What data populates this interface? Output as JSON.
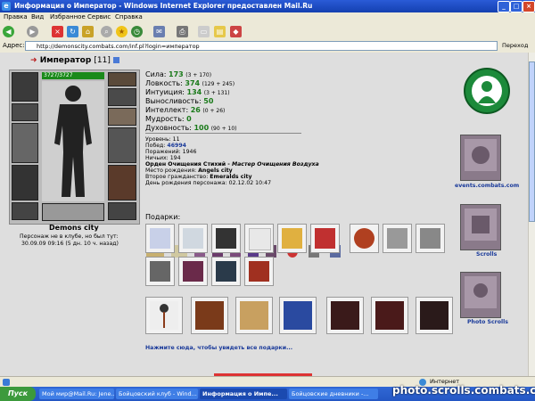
{
  "window": {
    "title": "Информация о Император - Windows Internet Explorer предоставлен Mail.Ru"
  },
  "menu": [
    "Правка",
    "Вид",
    "Избранное",
    "Сервис",
    "Справка"
  ],
  "address": {
    "label": "Адрес:",
    "url": "http://demonscity.combats.com/inf.pl?login=император",
    "go": "Переход"
  },
  "character": {
    "name": "Император",
    "level": "[11]",
    "hp": "3727/3727",
    "city": "Demons city",
    "absence": "Персонаж не в клубе, но был тут:",
    "last_seen": "30.09.09 09:16 (5 дн. 10 ч. назад)"
  },
  "stats": [
    {
      "label": "Сила:",
      "value": "173",
      "detail": "(3 + 170)"
    },
    {
      "label": "Ловкость:",
      "value": "374",
      "detail": "(129 + 245)"
    },
    {
      "label": "Интуиция:",
      "value": "134",
      "detail": "(3 + 131)"
    },
    {
      "label": "Выносливость:",
      "value": "50",
      "detail": ""
    },
    {
      "label": "Интеллект:",
      "value": "26",
      "detail": "(0 + 26)"
    },
    {
      "label": "Мудрость:",
      "value": "0",
      "detail": ""
    },
    {
      "label": "Духовность:",
      "value": "100",
      "detail": "(90 + 10)"
    }
  ],
  "info": {
    "level": "Уровень: 11",
    "wins_label": "Побед:",
    "wins": "46994",
    "losses": "Поражений: 1946",
    "draws": "Ничьих: 194",
    "order_prefix": "Орден Очищения Стихий -",
    "order_rank": "Мастер Очищения Воздуха",
    "birthplace_label": "Место рождения:",
    "birthplace": "Angels city",
    "second_citizenship_label": "Второе гражданство:",
    "second_citizenship": "Emeralds city",
    "birthday": "День рождения персонажа: 02.12.02 10:47"
  },
  "gifts_label": "Подарки:",
  "more_gifts_link": "Нажмите сюда, чтобы увидеть все подарки...",
  "right_panel": {
    "events_link": "events.combats.com",
    "scrolls_link": "Scrolls",
    "photo_scrolls_link": "Photo Scrolls"
  },
  "statusbar": {
    "zone": "Интернет"
  },
  "taskbar": {
    "start": "Пуск",
    "tasks": [
      "Мой мир@Mail.Ru: Jene...",
      "Бойцовский клуб - Wind...",
      "Информация о Импе...",
      "Бойцовские дневники -..."
    ]
  },
  "watermark": "photo.scrolls.combats.com",
  "colors": {
    "stat_green": "#1a7a1a",
    "title_blue": "#1440b0",
    "link_blue": "#1a3a9a",
    "emblem_green": "#1c8a3a"
  }
}
